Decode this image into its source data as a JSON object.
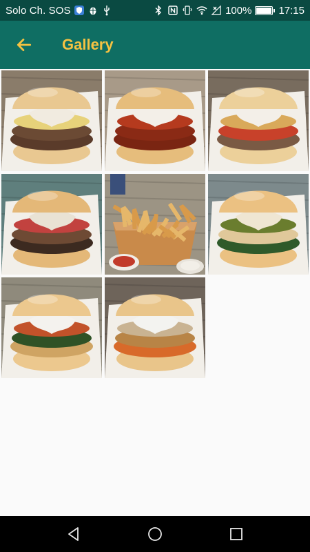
{
  "status_bar": {
    "carrier": "Solo Ch. SOS",
    "battery_percent": "100%",
    "battery_level": 1.0,
    "time": "17:15",
    "icons_left": [
      "shield-icon",
      "android-debug-icon",
      "usb-icon"
    ],
    "icons_right": [
      "bluetooth-icon",
      "nfc-icon",
      "vibrate-icon",
      "wifi-icon",
      "no-signal-icon",
      "battery-icon"
    ]
  },
  "app_bar": {
    "title": "Gallery",
    "back_icon": "arrow-left-icon",
    "background": "#0f6e63",
    "title_color": "#f5c242"
  },
  "gallery": {
    "columns": 3,
    "items": [
      {
        "subject": "burger",
        "bun": "#e9c891",
        "layers": [
          "#e7d27a",
          "#f1ebe0",
          "#6b4a34",
          "#5a3b2a"
        ],
        "background": "#8a7c6a"
      },
      {
        "subject": "burger",
        "bun": "#e6bd7c",
        "layers": [
          "#b53a1e",
          "#f3efe8",
          "#8a2a15",
          "#7a2512"
        ],
        "background": "#a89a88"
      },
      {
        "subject": "burger",
        "bun": "#ecd09a",
        "layers": [
          "#d9a95a",
          "#f3efe8",
          "#c8412a",
          "#7a5a44"
        ],
        "background": "#786c5e"
      },
      {
        "subject": "burger",
        "bun": "#e4b878",
        "layers": [
          "#c2423f",
          "#e9e2d4",
          "#6e4a34",
          "#3c2a20"
        ],
        "background": "#5f7f7d"
      },
      {
        "subject": "fries",
        "bun": "#d9a55f",
        "layers": [
          "#e6b76a",
          "#d89a4a",
          "#c23a2a",
          "#f2efe8"
        ],
        "background": "#9c9484"
      },
      {
        "subject": "burger",
        "bun": "#ebc182",
        "layers": [
          "#6a7d2e",
          "#efe6d2",
          "#e0c89a",
          "#2f5a2a"
        ],
        "background": "#7d8a8c"
      },
      {
        "subject": "burger",
        "bun": "#ecc88e",
        "layers": [
          "#c2522a",
          "#f4f2ee",
          "#2f5226",
          "#cfa463"
        ],
        "background": "#8f8a7c"
      },
      {
        "subject": "burger",
        "bun": "#e9c58a",
        "layers": [
          "#c9b392",
          "#f3f3f0",
          "#b88446",
          "#d86a2a"
        ],
        "background": "#6e645a"
      }
    ]
  },
  "nav_bar": {
    "back_icon": "triangle-back-icon",
    "home_icon": "circle-home-icon",
    "recents_icon": "square-recents-icon"
  }
}
